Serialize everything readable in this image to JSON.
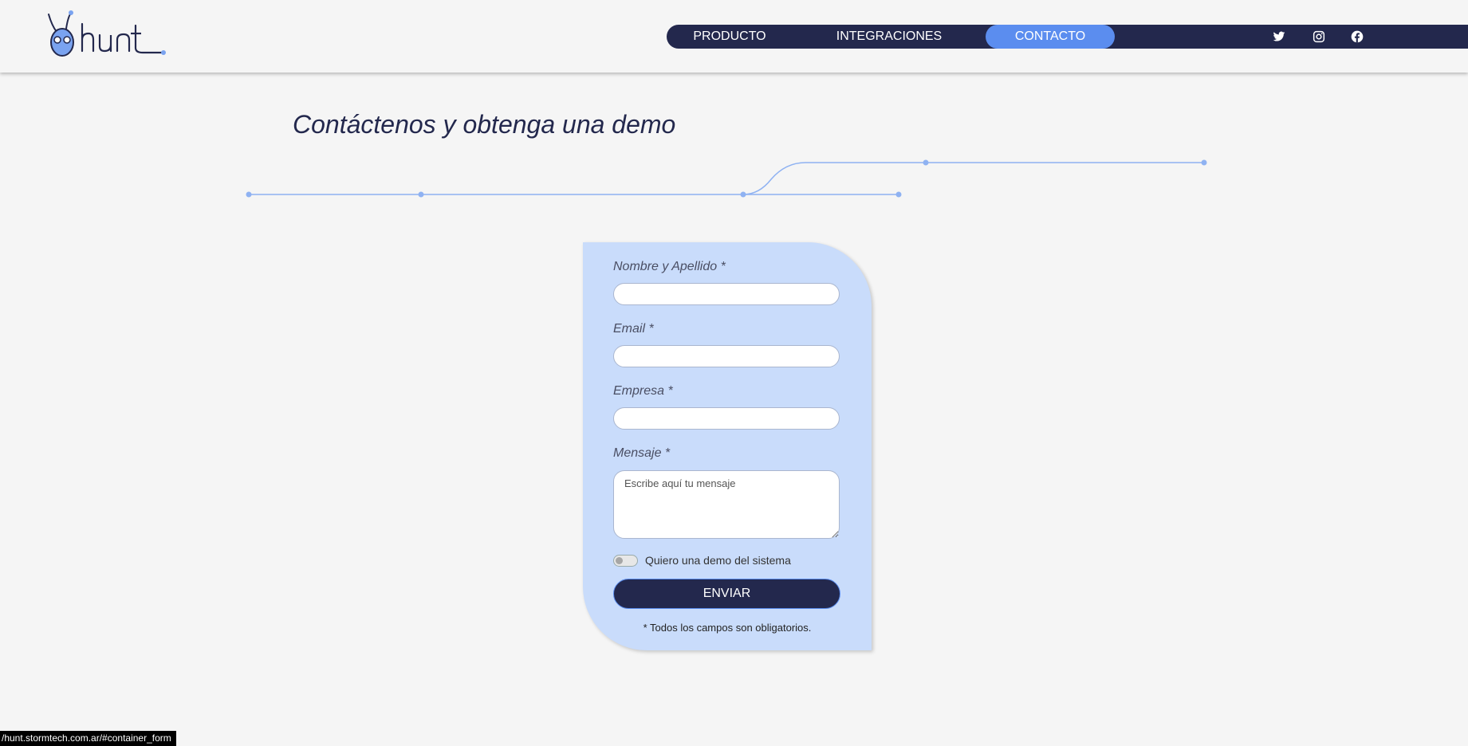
{
  "header": {
    "logo_text": "hunt",
    "nav": [
      {
        "label": "PRODUCTO"
      },
      {
        "label": "INTEGRACIONES"
      },
      {
        "label": "CONTACTO",
        "active": true
      }
    ],
    "social_icons": [
      "twitter-icon",
      "instagram-icon",
      "facebook-icon"
    ]
  },
  "page": {
    "title": "Contáctenos y obtenga una demo"
  },
  "form": {
    "name_label": "Nombre y Apellido *",
    "email_label": "Email *",
    "company_label": "Empresa *",
    "message_label": "Mensaje *",
    "message_placeholder": "Escribe aquí tu mensaje",
    "demo_toggle_label": "Quiero una demo del sistema",
    "demo_toggle_on": false,
    "submit_label": "ENVIAR",
    "required_note": "* Todos los campos son obligatorios."
  },
  "status_bar": {
    "url": "/hunt.stormtech.com.ar/#container_form"
  },
  "colors": {
    "navy": "#23284d",
    "accent": "#5b8def",
    "card": "#c9dcfb",
    "background": "#f5f5f5"
  }
}
